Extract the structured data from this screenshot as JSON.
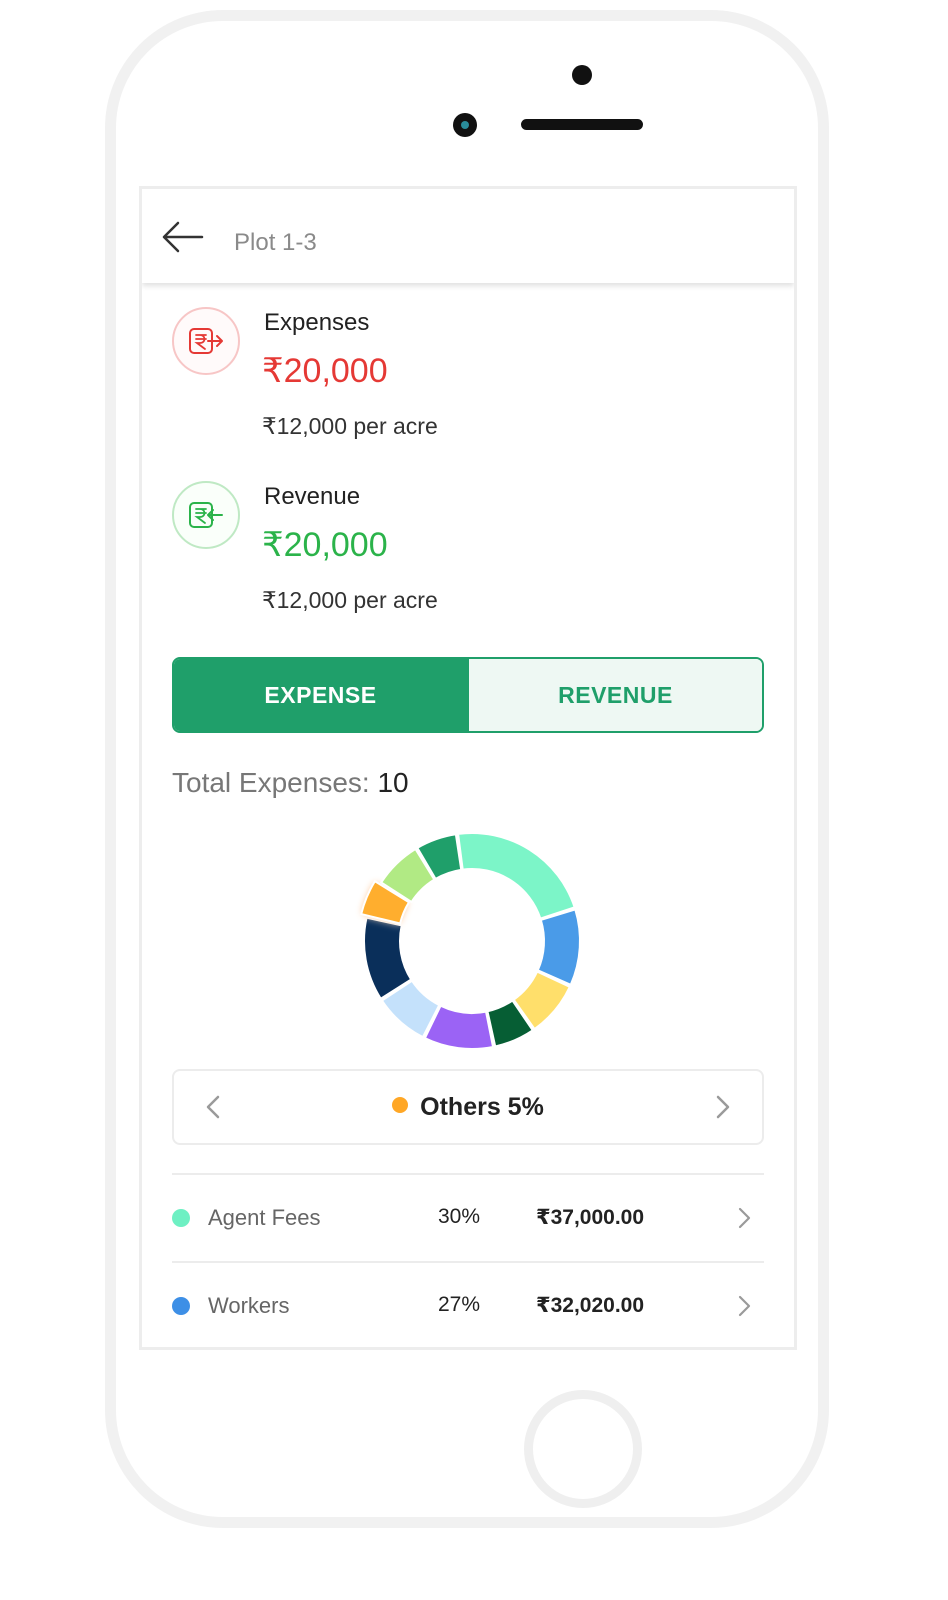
{
  "header": {
    "title": "Plot 1-3"
  },
  "summary": {
    "expenses": {
      "label": "Expenses",
      "amount": "₹20,000",
      "per_acre": "₹12,000 per acre"
    },
    "revenue": {
      "label": "Revenue",
      "amount": "₹20,000",
      "per_acre": "₹12,000 per acre"
    }
  },
  "toggle": {
    "expense_label": "EXPENSE",
    "revenue_label": "REVENUE",
    "active": "expense"
  },
  "total": {
    "label": "Total Expenses:",
    "value": "10"
  },
  "chart_data": {
    "type": "pie",
    "series": [
      {
        "name": "Agent Fees",
        "value": 21,
        "color": "#7cf5c8"
      },
      {
        "name": "Workers",
        "value": 11,
        "color": "#4a9be8"
      },
      {
        "name": "",
        "value": 8,
        "color": "#ffdf6b"
      },
      {
        "name": "",
        "value": 6,
        "color": "#065e34"
      },
      {
        "name": "",
        "value": 10,
        "color": "#9b63f5"
      },
      {
        "name": "",
        "value": 8,
        "color": "#c4e1fb"
      },
      {
        "name": "",
        "value": 12,
        "color": "#0a2f5a"
      },
      {
        "name": "Others",
        "value": 5,
        "color": "#ffae2e"
      },
      {
        "name": "",
        "value": 7,
        "color": "#b1ea84"
      },
      {
        "name": "",
        "value": 6,
        "color": "#1f9f6a"
      }
    ],
    "highlighted": "Others"
  },
  "selector": {
    "label": "Others 5%",
    "dot_color": "#ffa726"
  },
  "rows": [
    {
      "name": "Agent Fees",
      "percent": "30%",
      "amount": "₹37,000.00",
      "color": "#6ef0c3"
    },
    {
      "name": "Workers",
      "percent": "27%",
      "amount": "₹32,020.00",
      "color": "#3d8fe6"
    }
  ]
}
